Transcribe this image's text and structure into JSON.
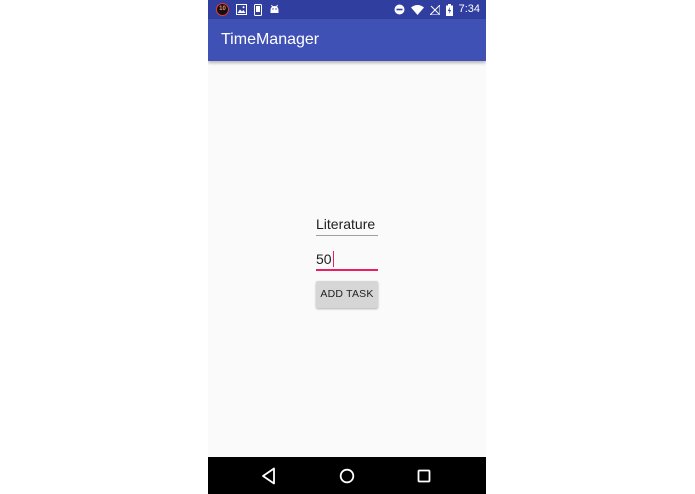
{
  "status_bar": {
    "notification_badge": "10",
    "time": "7:34",
    "left_icons": [
      "notification-badge",
      "image-icon",
      "device-icon",
      "android-icon"
    ],
    "right_icons": [
      "do-not-disturb-icon",
      "wifi-icon",
      "no-signal-icon",
      "battery-charging-icon"
    ]
  },
  "app_bar": {
    "title": "TimeManager",
    "color": "#3f51b5",
    "status_color": "#303f9f"
  },
  "form": {
    "task_name_value": "Literature",
    "minutes_value": "50",
    "add_button_label": "ADD TASK",
    "accent_color": "#e91e63"
  },
  "nav_bar": {
    "buttons": [
      "back-icon",
      "home-icon",
      "recents-icon"
    ]
  }
}
